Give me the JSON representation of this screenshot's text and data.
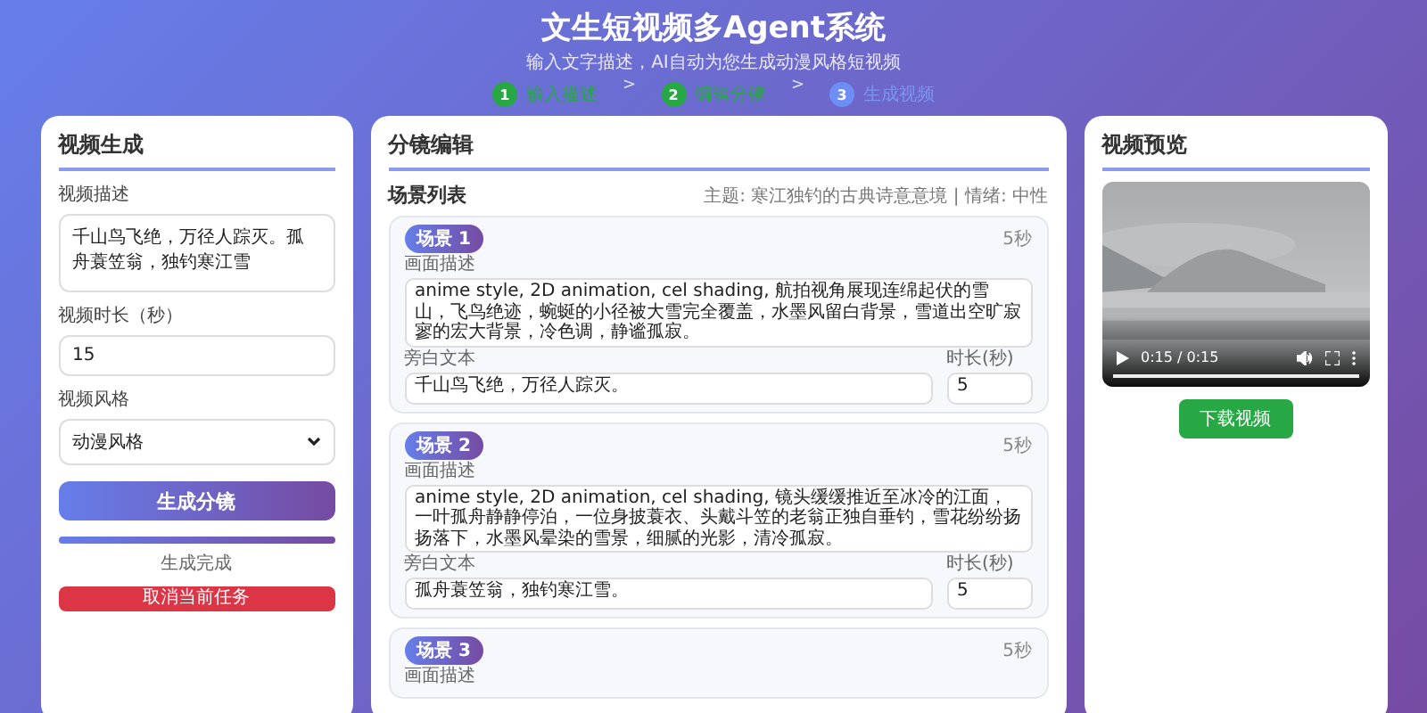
{
  "header": {
    "title": "文生短视频多Agent系统",
    "subtitle": "输入文字描述，AI自动为您生成动漫风格短视频"
  },
  "steps": {
    "items": [
      {
        "number": "1",
        "label": "输入描述",
        "completed": true
      },
      {
        "number": "2",
        "label": "编辑分镜",
        "completed": true
      },
      {
        "number": "3",
        "label": "生成视频",
        "completed": false
      }
    ],
    "separators": [
      ">",
      ">"
    ]
  },
  "generate_panel": {
    "title": "视频生成",
    "description_label": "视频描述",
    "description_value": "千山鸟飞绝，万径人踪灭。孤舟蓑笠翁，独钓寒江雪",
    "duration_label": "视频时长（秒）",
    "duration_value": "15",
    "style_label": "视频风格",
    "style_value": "动漫风格",
    "generate_button": "生成分镜",
    "progress": {
      "level": 1,
      "text": "生成完成"
    },
    "cancel_button": "取消当前任务"
  },
  "storyboard_panel": {
    "title": "分镜编辑",
    "list_title": "场景列表",
    "meta": "主题: 寒江独钓的古典诗意意境 | 情绪: 中性",
    "scenes": [
      {
        "badge": "场景 1",
        "duration": "5秒",
        "description_label": "画面描述",
        "description": "anime style, 2D animation, cel shading, 航拍视角展现连绵起伏的雪山，飞鸟绝迹，蜿蜒的小径被大雪完全覆盖，水墨风留白背景，雪道出空旷寂寥的宏大背景，冷色调，静谧孤寂。",
        "narration_label": "旁白文本",
        "narration": "千山鸟飞绝，万径人踪灭。",
        "seconds_label": "时长(秒)",
        "seconds": "5"
      },
      {
        "badge": "场景 2",
        "duration": "5秒",
        "description_label": "画面描述",
        "description": "anime style, 2D animation, cel shading, 镜头缓缓推近至冰冷的江面，一叶孤舟静静停泊，一位身披蓑衣、头戴斗笠的老翁正独自垂钓，雪花纷纷扬扬落下，水墨风晕染的雪景，细腻的光影，清冷孤寂。",
        "narration_label": "旁白文本",
        "narration": "孤舟蓑笠翁，独钓寒江雪。",
        "seconds_label": "时长(秒)",
        "seconds": "5"
      },
      {
        "badge": "场景 3",
        "duration": "5秒",
        "description_label": "画面描述"
      }
    ]
  },
  "preview_panel": {
    "title": "视频预览",
    "video": {
      "time": "0:15 / 0:15",
      "level": 1
    },
    "download_button": "下载视频"
  }
}
